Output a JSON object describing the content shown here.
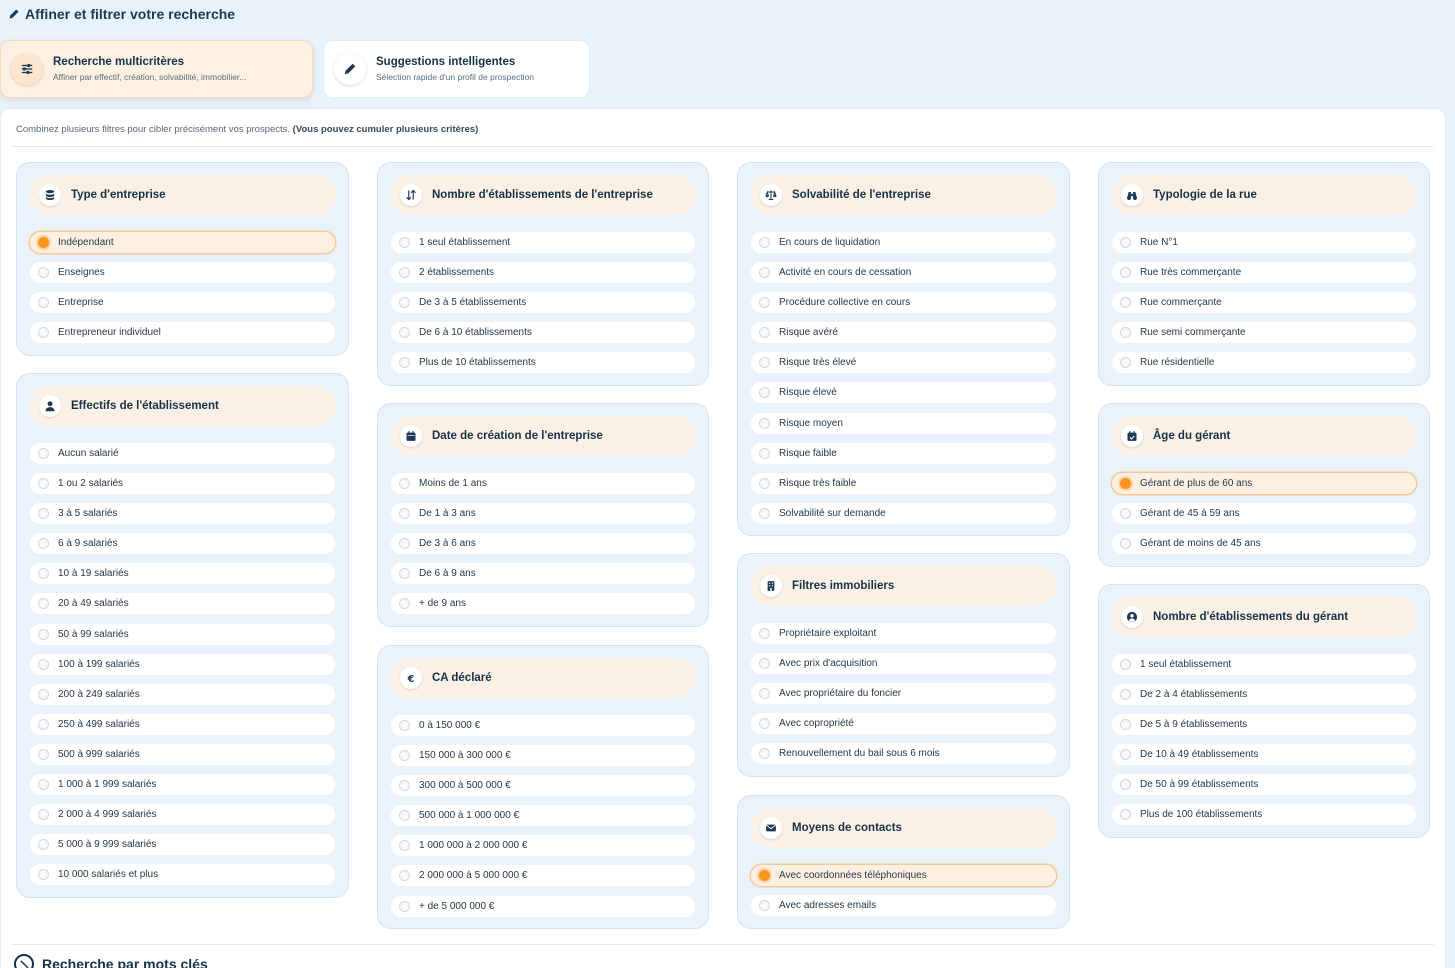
{
  "header": {
    "title": "Affiner et filtrer votre recherche"
  },
  "tabs": [
    {
      "title": "Recherche multicritères",
      "subtitle": "Affiner par effectif, création, solvabilité, immobilier...",
      "icon": "sliders-icon",
      "active": true
    },
    {
      "title": "Suggestions intelligentes",
      "subtitle": "Sélection rapide d'un profil de prospection",
      "icon": "pencil-icon",
      "active": false
    }
  ],
  "intro": {
    "text": "Combinez plusieurs filtres pour cibler précisément vos prospects.",
    "bold": "(Vous pouvez cumuler plusieurs critères)"
  },
  "cards": {
    "type_entreprise": {
      "title": "Type d'entreprise",
      "icon": "database-icon",
      "options": [
        "Indépendant",
        "Enseignes",
        "Entreprise",
        "Entrepreneur individuel"
      ],
      "selected": "Indépendant"
    },
    "effectifs": {
      "title": "Effectifs de l'établissement",
      "icon": "person-icon",
      "options": [
        "Aucun salarié",
        "1 ou 2 salariés",
        "3 à 5 salariés",
        "6 à 9 salariés",
        "10 à 19 salariés",
        "20 à 49 salariés",
        "50 à 99 salariés",
        "100 à 199 salariés",
        "200 à 249 salariés",
        "250 à 499 salariés",
        "500 à 999 salariés",
        "1 000 à 1 999 salariés",
        "2 000 à 4 999 salariés",
        "5 000 à 9 999 salariés",
        "10 000 salariés et plus"
      ]
    },
    "nb_etablissements": {
      "title": "Nombre d'établissements de l'entreprise",
      "icon": "sort-icon",
      "options": [
        "1 seul établissement",
        "2 établissements",
        "De 3 à 5 établissements",
        "De 6 à 10 établissements",
        "Plus de 10 établissements"
      ]
    },
    "date_creation": {
      "title": "Date de création de l'entreprise",
      "icon": "calendar-icon",
      "options": [
        "Moins de 1 ans",
        "De 1 à 3 ans",
        "De 3 à 6 ans",
        "De 6 à 9 ans",
        "+ de 9 ans"
      ]
    },
    "ca_declare": {
      "title": "CA déclaré",
      "icon": "euro-icon",
      "options": [
        "0 à 150 000 €",
        "150 000 à 300 000 €",
        "300 000 à 500 000 €",
        "500 000 à 1 000 000 €",
        "1 000 000 à 2 000 000 €",
        "2 000 000 à 5 000 000 €",
        "+ de 5 000 000 €"
      ]
    },
    "solvabilite": {
      "title": "Solvabilité de l'entreprise",
      "icon": "scale-icon",
      "options": [
        "En cours de liquidation",
        "Activité en cours de cessation",
        "Procédure collective en cours",
        "Risque avéré",
        "Risque très élevé",
        "Risque élevé",
        "Risque moyen",
        "Risque faible",
        "Risque très faible",
        "Solvabilité sur demande"
      ]
    },
    "immobiliers": {
      "title": "Filtres immobiliers",
      "icon": "building-icon",
      "options": [
        "Propriétaire exploitant",
        "Avec prix d'acquisition",
        "Avec propriétaire du foncier",
        "Avec copropriété",
        "Renouvellement du bail sous 6 mois"
      ]
    },
    "contacts": {
      "title": "Moyens de contacts",
      "icon": "envelope-icon",
      "options": [
        "Avec coordonnées téléphoniques",
        "Avec adresses emails"
      ],
      "selected": "Avec coordonnées téléphoniques"
    },
    "typologie_rue": {
      "title": "Typologie de la rue",
      "icon": "binoculars-icon",
      "options": [
        "Rue N°1",
        "Rue très commerçante",
        "Rue commerçante",
        "Rue semi commerçante",
        "Rue résidentielle"
      ]
    },
    "age_gerant": {
      "title": "Âge du gérant",
      "icon": "calendar-check-icon",
      "options": [
        "Gérant de plus de 60 ans",
        "Gérant de 45 à 59 ans",
        "Gérant de moins de 45 ans"
      ],
      "selected": "Gérant de plus de 60 ans"
    },
    "etab_gerant": {
      "title": "Nombre d'établissements du gérant",
      "icon": "user-circle-icon",
      "options": [
        "1 seul établissement",
        "De 2 à 4 établissements",
        "De 5 à 9 établissements",
        "De 10 à 49 établissements",
        "De 50 à 99 établissements",
        "Plus de 100 établissements"
      ]
    }
  },
  "keywords": {
    "title": "Recherche par mots clés"
  }
}
